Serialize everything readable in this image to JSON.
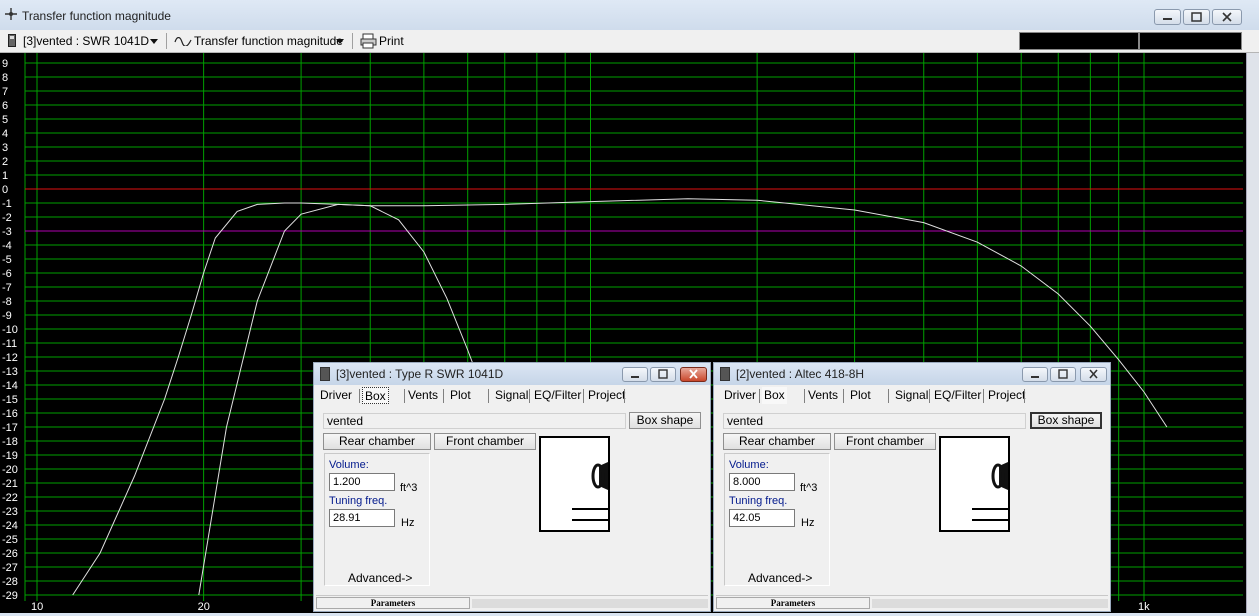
{
  "window": {
    "title": "Transfer function magnitude"
  },
  "toolbar": {
    "driver_select": "[3]vented : SWR 1041D",
    "plot_select": "Transfer function magnitude",
    "print_label": "Print"
  },
  "chart_data": {
    "type": "line",
    "xscale": "log",
    "xlim": [
      10,
      1000
    ],
    "ylim": [
      -29,
      9
    ],
    "y_ticks": [
      "9",
      "8",
      "7",
      "6",
      "5",
      "4",
      "3",
      "2",
      "1",
      "0",
      "-1",
      "-2",
      "-3",
      "-4",
      "-5",
      "-6",
      "-7",
      "-8",
      "-9",
      "-10",
      "-11",
      "-12",
      "-13",
      "-14",
      "-15",
      "-16",
      "-17",
      "-18",
      "-19",
      "-20",
      "-21",
      "-22",
      "-23",
      "-24",
      "-25",
      "-26",
      "-27",
      "-28",
      "-29"
    ],
    "x_labels": [
      {
        "value": 10,
        "label": "10"
      },
      {
        "value": 20,
        "label": "20"
      },
      {
        "value": 1000,
        "label": "1k"
      }
    ],
    "reference_lines": [
      {
        "y": 0,
        "color": "#e01010"
      },
      {
        "y": -3,
        "color": "#b000b0"
      }
    ],
    "grid": true,
    "grid_color": "#00a000",
    "series": [
      {
        "x": [
          11.6,
          13,
          15,
          17,
          18,
          19,
          20,
          21,
          23,
          25,
          28,
          30,
          35,
          40,
          50,
          70,
          100,
          150,
          200,
          300,
          400,
          500,
          600,
          700,
          800,
          900,
          1000,
          1100
        ],
        "y": [
          -29,
          -26,
          -20.5,
          -15,
          -12,
          -9,
          -6,
          -3.5,
          -1.6,
          -1.1,
          -1.0,
          -1.0,
          -1.1,
          -1.2,
          -1.2,
          -1.1,
          -0.9,
          -0.7,
          -0.8,
          -1.5,
          -2.4,
          -3.8,
          -5.5,
          -7.5,
          -9.8,
          -12.2,
          -14.5,
          -17
        ]
      },
      {
        "x": [
          19.6,
          22,
          25,
          28,
          30,
          35,
          40,
          45,
          50,
          55,
          60,
          62
        ],
        "y": [
          -29,
          -17,
          -8,
          -3,
          -1.8,
          -1.1,
          -1.2,
          -2.2,
          -4.5,
          -7.8,
          -11.5,
          -13
        ]
      }
    ],
    "curve_color": "#e0e0e0"
  },
  "panels": [
    {
      "title": "[3]vented : Type R SWR 1041D",
      "active": true,
      "tabs": [
        "Driver",
        "Box",
        "Vents",
        "Plot",
        "Signal",
        "EQ/Filter",
        "Project"
      ],
      "selected_tab": "Box",
      "box_type": "vented",
      "box_shape_label": "Box shape",
      "rear_chamber_label": "Rear chamber",
      "front_chamber_label": "Front chamber",
      "volume_label": "Volume:",
      "volume_value": "1.200",
      "volume_unit": "ft^3",
      "tuning_label": "Tuning freq.",
      "tuning_value": "28.91",
      "tuning_unit": "Hz",
      "advanced_label": "Advanced->",
      "status_tab": "Parameters"
    },
    {
      "title": "[2]vented : Altec 418-8H",
      "active": false,
      "tabs": [
        "Driver",
        "Box",
        "Vents",
        "Plot",
        "Signal",
        "EQ/Filter",
        "Project"
      ],
      "selected_tab": "Box",
      "box_type": "vented",
      "box_shape_label": "Box shape",
      "rear_chamber_label": "Rear chamber",
      "front_chamber_label": "Front chamber",
      "volume_label": "Volume:",
      "volume_value": "8.000",
      "volume_unit": "ft^3",
      "tuning_label": "Tuning freq.",
      "tuning_value": "42.05",
      "tuning_unit": "Hz",
      "advanced_label": "Advanced->",
      "status_tab": "Parameters"
    }
  ]
}
